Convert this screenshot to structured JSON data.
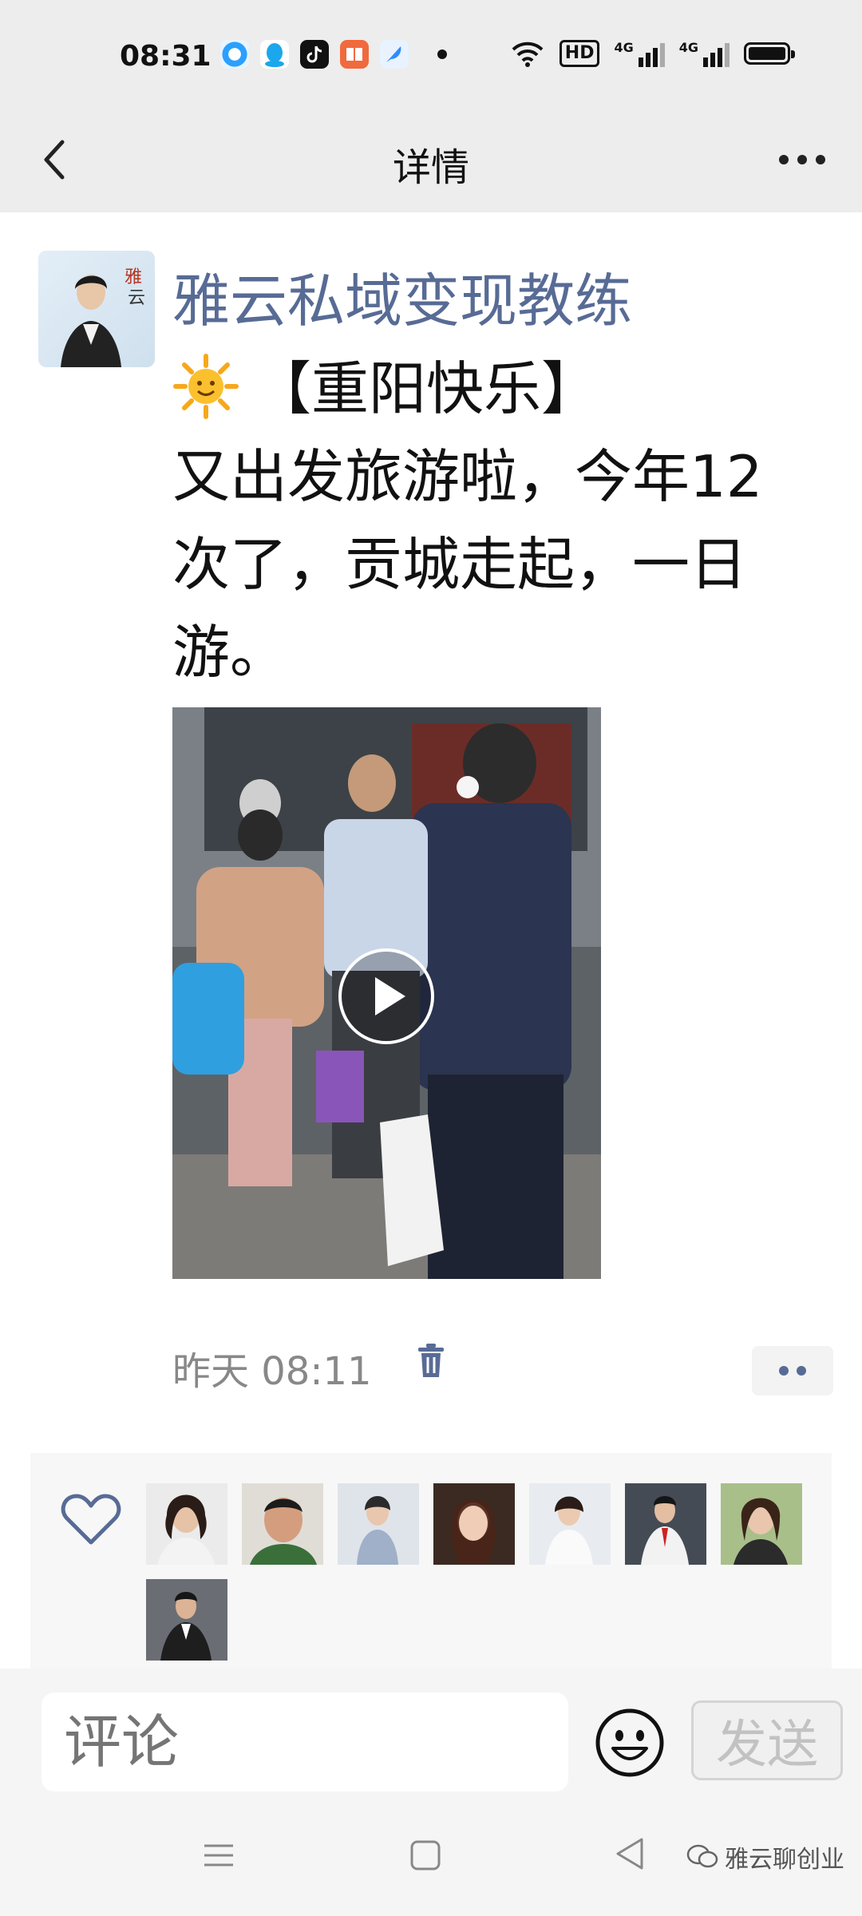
{
  "status_bar": {
    "time": "08:31",
    "hd_label": "HD",
    "network_1": "4G",
    "network_2": "4G"
  },
  "nav": {
    "title": "详情"
  },
  "post": {
    "author": "雅云私域变现教练",
    "headline": "【重阳快乐】",
    "body_lines": [
      "又出发旅游啦，今年12",
      "次了，贡城走起，一日",
      "游。"
    ],
    "timestamp": "昨天 08:11"
  },
  "likes": {
    "count": 8
  },
  "composer": {
    "placeholder": "评论",
    "send_label": "发送"
  },
  "watermark": {
    "text": "雅云聊创业"
  },
  "colors": {
    "author_blue": "#576b95",
    "page_bg": "#ededed",
    "heart_blue": "#576b95"
  }
}
